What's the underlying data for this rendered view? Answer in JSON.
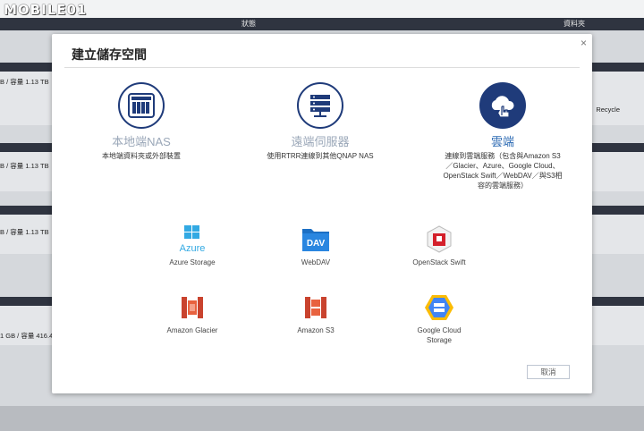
{
  "watermark": "MOBILE01",
  "app_header": {
    "col_status": "狀態",
    "col_folder": "資料夾"
  },
  "background_rows": [
    {
      "capacity": "B / 容量  1.13 TB"
    },
    {
      "capacity": "B / 容量  1.13 TB"
    },
    {
      "capacity": "B / 容量  1.13 TB"
    },
    {
      "capacity": "1 GB / 容量  416.4"
    }
  ],
  "background_right_label": "Recycle",
  "dialog": {
    "title": "建立儲存空間",
    "close_label": "×",
    "options": [
      {
        "title": "本地端NAS",
        "desc": "本地端資料夾或外部裝置",
        "icon": "nas-device-icon"
      },
      {
        "title": "遠端伺服器",
        "desc": "使用RTRR連線到其他QNAP NAS",
        "icon": "server-rack-icon"
      },
      {
        "title": "雲端",
        "desc": "連線到雲端服務（包含與Amazon S3／Glacier、Azure、Google Cloud、OpenStack Swift／WebDAV／與S3相容的雲端服務）",
        "icon": "cloud-icon"
      }
    ],
    "services": [
      {
        "label": "Azure Storage",
        "icon": "azure-icon",
        "icon_text": "Azure"
      },
      {
        "label": "WebDAV",
        "icon": "webdav-icon",
        "icon_text": "DAV"
      },
      {
        "label": "OpenStack Swift",
        "icon": "openstack-icon"
      },
      {
        "label": "Amazon Glacier",
        "icon": "amazon-glacier-icon"
      },
      {
        "label": "Amazon S3",
        "icon": "amazon-s3-icon"
      },
      {
        "label": "Google Cloud Storage",
        "icon": "google-cloud-icon"
      }
    ],
    "cancel_label": "取消"
  },
  "colors": {
    "accent": "#1f3b7a",
    "active_text": "#2c6ab3",
    "inactive_text": "#9aa7b8"
  }
}
